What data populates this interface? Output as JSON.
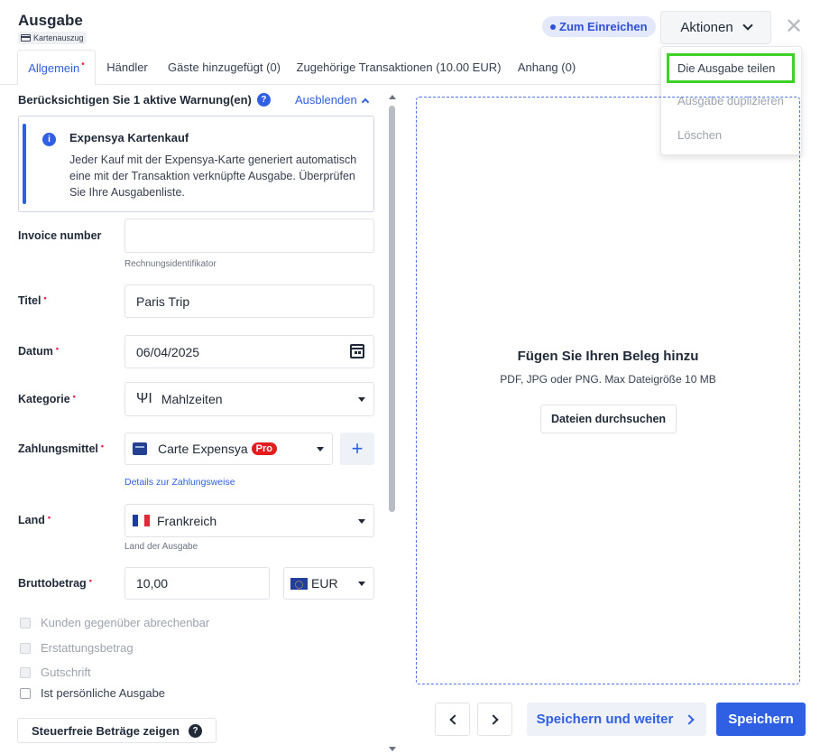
{
  "header": {
    "title": "Ausgabe",
    "subtitle_badge": "Kartenauszug",
    "status": "Zum Einreichen",
    "actions_label": "Aktionen",
    "close": "✕"
  },
  "tabs": [
    {
      "label": "Allgemein",
      "required": "•"
    },
    {
      "label": "Händler"
    },
    {
      "label": "Gäste hinzugefügt (0)"
    },
    {
      "label": "Zugehörige Transaktionen (10.00 EUR)"
    },
    {
      "label": "Anhang (0)"
    }
  ],
  "actions_menu": {
    "items": [
      "Die Ausgabe teilen",
      "Ausgabe duplizieren",
      "Löschen"
    ]
  },
  "warnings": {
    "heading": "Berücksichtigen Sie 1 aktive Warnung(en)",
    "help": "?",
    "hide_label": "Ausblenden",
    "info_icon": "i",
    "info_title": "Expensya Kartenkauf",
    "info_body": "Jeder Kauf mit der Expensya-Karte generiert automatisch eine mit der Transaktion verknüpfte Ausgabe. Überprüfen Sie Ihre Ausgabenliste."
  },
  "form": {
    "invoice": {
      "label": "Invoice number",
      "value": "",
      "hint": "Rechnungsidentifikator"
    },
    "title": {
      "label": "Titel",
      "value": "Paris Trip"
    },
    "date": {
      "label": "Datum",
      "value": "06/04/2025"
    },
    "category": {
      "label": "Kategorie",
      "value": "Mahlzeiten"
    },
    "payment": {
      "label": "Zahlungsmittel",
      "value": "Carte Expensya",
      "badge": "Pro",
      "link": "Details zur Zahlungsweise",
      "add": "+"
    },
    "country": {
      "label": "Land",
      "value": "Frankreich",
      "hint": "Land der Ausgabe"
    },
    "gross": {
      "label": "Bruttobetrag",
      "value": "10,00",
      "currency": "EUR"
    },
    "required_mark": "•"
  },
  "checkboxes": [
    {
      "label": "Kunden gegenüber abrechenbar",
      "enabled": false
    },
    {
      "label": "Erstattungsbetrag",
      "enabled": false
    },
    {
      "label": "Gutschrift",
      "enabled": false
    },
    {
      "label": "Ist persönliche Ausgabe",
      "enabled": true
    }
  ],
  "tax_button": {
    "label": "Steuerfreie Beträge zeigen",
    "help": "?"
  },
  "receipt": {
    "title": "Fügen Sie Ihren Beleg hinzu",
    "subtitle": "PDF, JPG oder PNG. Max Dateigröße 10 MB",
    "browse_label": "Dateien durchsuchen"
  },
  "footer": {
    "save_next_label": "Speichern und weiter",
    "save_label": "Speichern"
  },
  "colors": {
    "accent": "#2f5fe3",
    "required": "#e11d48",
    "highlight": "#3fd128",
    "pro": "#e11d1d"
  }
}
